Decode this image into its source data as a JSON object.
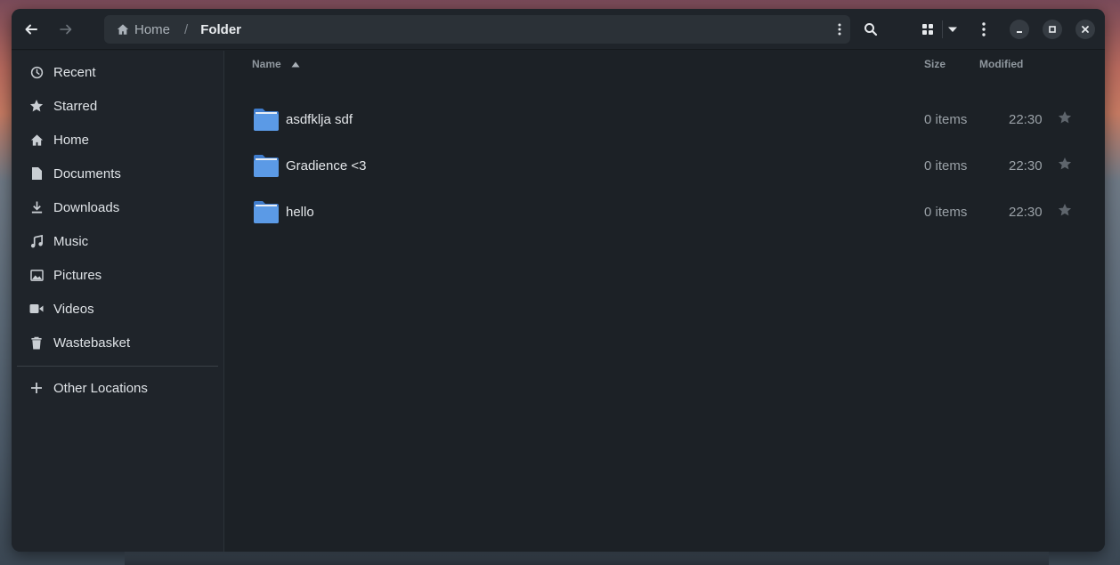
{
  "toolbar": {
    "back_icon": "arrow-left-icon",
    "forward_icon": "arrow-right-icon",
    "search_icon": "search-icon",
    "view_icon": "grid-view-icon",
    "menu_icon": "kebab-menu-icon"
  },
  "pathbar": {
    "home_label": "Home",
    "separator": "/",
    "current_label": "Folder"
  },
  "sidebar": {
    "items": [
      {
        "label": "Recent",
        "icon": "clock-icon"
      },
      {
        "label": "Starred",
        "icon": "star-icon"
      },
      {
        "label": "Home",
        "icon": "home-icon"
      },
      {
        "label": "Documents",
        "icon": "document-icon"
      },
      {
        "label": "Downloads",
        "icon": "download-icon"
      },
      {
        "label": "Music",
        "icon": "music-icon"
      },
      {
        "label": "Pictures",
        "icon": "picture-icon"
      },
      {
        "label": "Videos",
        "icon": "video-icon"
      },
      {
        "label": "Wastebasket",
        "icon": "trash-icon"
      }
    ],
    "other_locations": "Other Locations"
  },
  "columns": {
    "name": "Name",
    "size": "Size",
    "modified": "Modified"
  },
  "files": [
    {
      "name": "asdfklja sdf",
      "size": "0 items",
      "modified": "22:30"
    },
    {
      "name": "Gradience <3",
      "size": "0 items",
      "modified": "22:30"
    },
    {
      "name": "hello",
      "size": "0 items",
      "modified": "22:30"
    }
  ],
  "colors": {
    "folder": "#5b9ae6",
    "background": "#1c2126"
  }
}
